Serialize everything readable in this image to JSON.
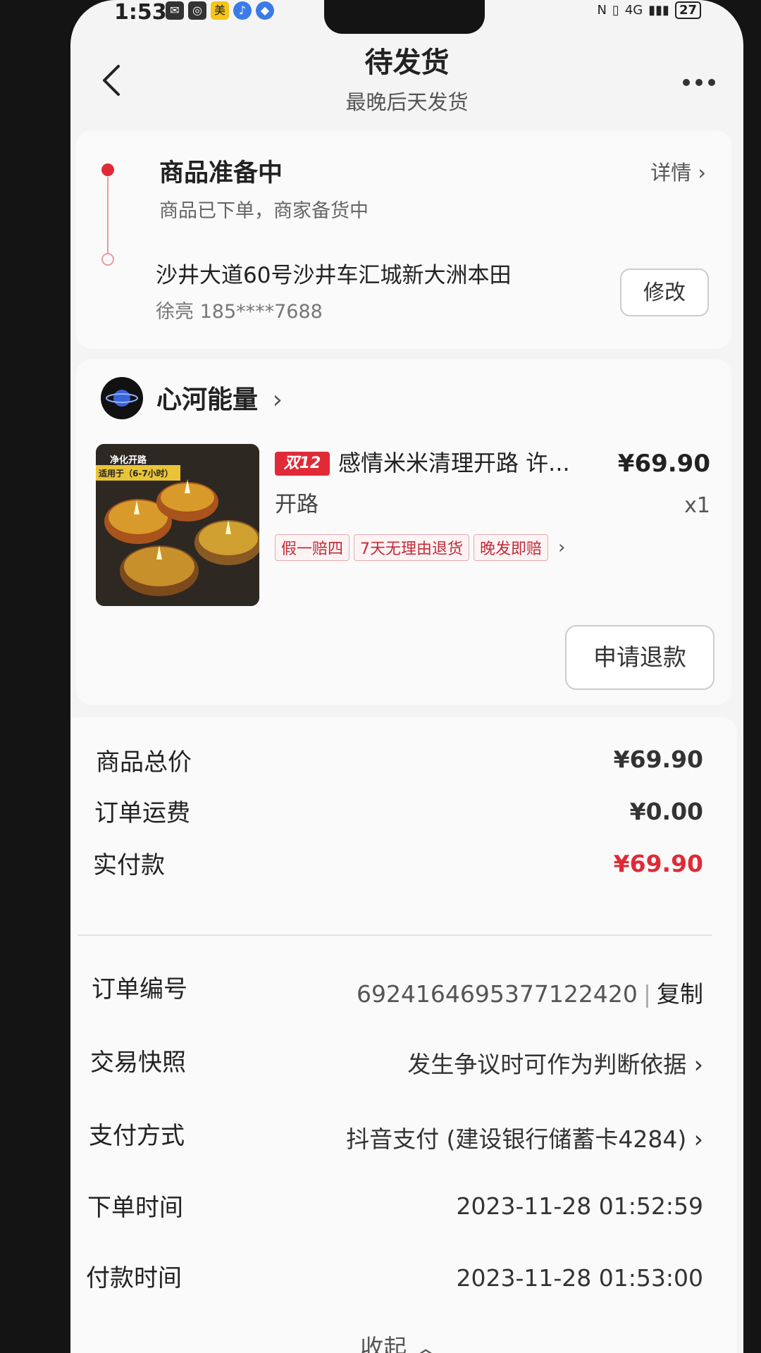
{
  "status_bar": {
    "time": "1:53",
    "battery": "27",
    "network": "4G"
  },
  "header": {
    "title": "待发货",
    "subtitle": "最晚后天发货"
  },
  "shipping": {
    "status_title": "商品准备中",
    "status_desc": "商品已下单，商家备货中",
    "detail_link": "详情",
    "address": "沙井大道60号沙井车汇城新大洲本田",
    "contact": "徐亮 185****7688",
    "modify_label": "修改"
  },
  "shop": {
    "name": "心河能量",
    "product": {
      "promo_tag": "双12",
      "title": "感情米米清理开路 许...",
      "subtitle": "开路",
      "price": "¥69.90",
      "quantity": "x1",
      "thumb_text": [
        "净化开路",
        "适用于（6-7小时）"
      ],
      "badges": [
        "假一赔四",
        "7天无理由退货",
        "晚发即赔"
      ]
    },
    "refund_label": "申请退款"
  },
  "summary": {
    "total_label": "商品总价",
    "total_value": "¥69.90",
    "shipping_label": "订单运费",
    "shipping_value": "¥0.00",
    "paid_label": "实付款",
    "paid_value": "¥69.90"
  },
  "order_info": {
    "number_label": "订单编号",
    "number_value": "6924164695377122420",
    "copy_label": "复制",
    "snapshot_label": "交易快照",
    "snapshot_value": "发生争议时可作为判断依据",
    "payment_label": "支付方式",
    "payment_value": "抖音支付 (建设银行储蓄卡4284)",
    "order_time_label": "下单时间",
    "order_time_value": "2023-11-28 01:52:59",
    "pay_time_label": "付款时间",
    "pay_time_value": "2023-11-28 01:53:00"
  },
  "collapse_label": "收起",
  "colors": {
    "accent": "#e02a37",
    "background": "#f4f4f4",
    "card": "#fafafa"
  }
}
